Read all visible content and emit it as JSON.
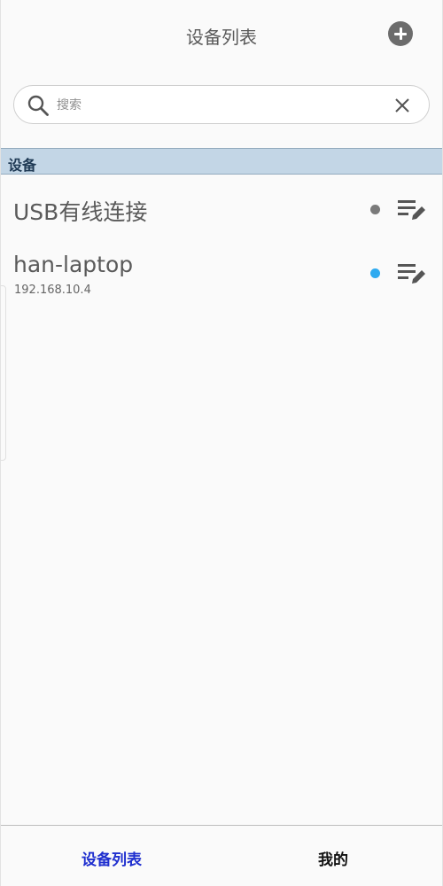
{
  "header": {
    "title": "设备列表",
    "add_icon": "plus-circle-icon"
  },
  "search": {
    "placeholder": "搜索",
    "value": "",
    "search_icon": "search-icon",
    "clear_icon": "close-icon"
  },
  "section": {
    "title": "设备"
  },
  "devices": [
    {
      "name": "USB有线连接",
      "address": "",
      "status_color": "#7a7a7a",
      "edit_icon": "edit-list-icon"
    },
    {
      "name": "han-laptop",
      "address": "192.168.10.4",
      "status_color": "#2eaaf0",
      "edit_icon": "edit-list-icon"
    }
  ],
  "bottom_nav": {
    "tabs": [
      {
        "label": "设备列表",
        "active": true,
        "color": "#1f2fcf"
      },
      {
        "label": "我的",
        "active": false,
        "color": "#111111"
      }
    ]
  },
  "colors": {
    "section_bg": "#c3d6e6",
    "section_text": "#1f3a55",
    "background": "#fafafa"
  }
}
